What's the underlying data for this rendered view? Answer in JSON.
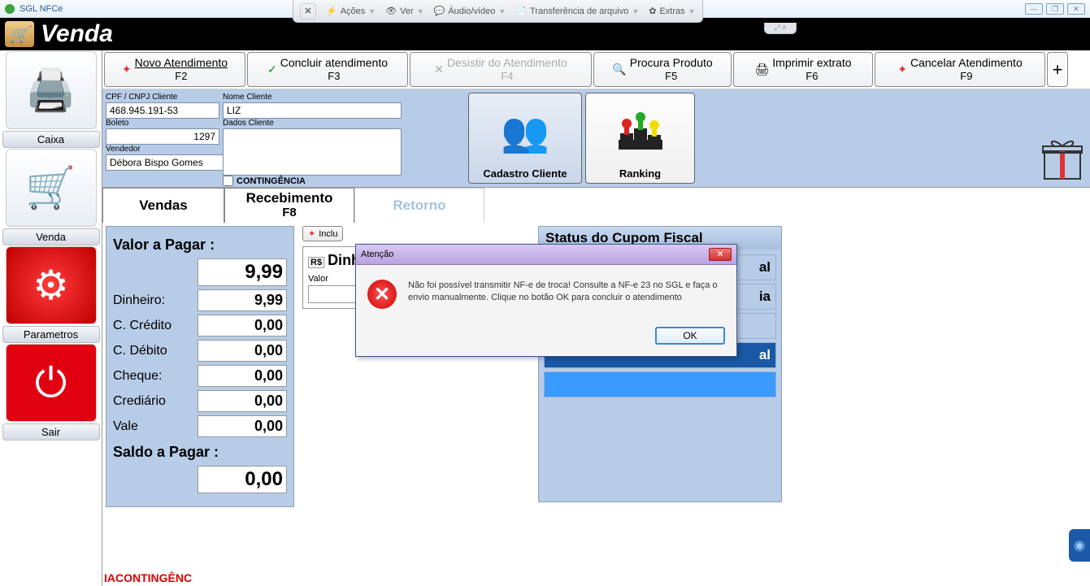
{
  "window": {
    "title": "SGL NFCe"
  },
  "remote_toolbar": {
    "actions": "Ações",
    "ver": "Ver",
    "audio": "Áudio/vídeo",
    "transfer": "Transferência de arquivo",
    "extras": "Extras"
  },
  "header": {
    "title": "Venda"
  },
  "sidebar": {
    "caixa": "Caixa",
    "venda": "Venda",
    "parametros": "Parametros",
    "sair": "Sair"
  },
  "actions": {
    "novo": {
      "label": "Novo Atendimento",
      "shortcut": "F2"
    },
    "concluir": {
      "label": "Concluir atendimento",
      "shortcut": "F3"
    },
    "desistir": {
      "label": "Desistir do Atendimento",
      "shortcut": "F4"
    },
    "procura": {
      "label": "Procura Produto",
      "shortcut": "F5"
    },
    "imprimir": {
      "label": "Imprimir extrato",
      "shortcut": "F6"
    },
    "cancelar": {
      "label": "Cancelar Atendimento",
      "shortcut": "F9"
    }
  },
  "client": {
    "cpf_label": "CPF / CNPJ Cliente",
    "cpf_value": "468.945.191-53",
    "nome_label": "Nome Cliente",
    "nome_value": "LIZ",
    "boleto_label": "Boleto",
    "boleto_value": "1297",
    "dados_label": "Dados Cliente",
    "dados_value": "",
    "vendedor_label": "Vendedor",
    "vendedor_value": "Débora Bispo Gomes",
    "contingencia_label": "CONTINGÊNCIA",
    "cadastro_btn": "Cadastro Cliente",
    "ranking_btn": "Ranking"
  },
  "tabs": {
    "vendas": "Vendas",
    "recebimento": {
      "label": "Recebimento",
      "shortcut": "F8"
    },
    "retorno": "Retorno"
  },
  "payment": {
    "title": "Valor a Pagar :",
    "total": "9,99",
    "rows": {
      "dinheiro": {
        "label": "Dinheiro:",
        "value": "9,99"
      },
      "ccredito": {
        "label": "C. Crédito",
        "value": "0,00"
      },
      "cdebito": {
        "label": "C. Débito",
        "value": "0,00"
      },
      "cheque": {
        "label": "Cheque:",
        "value": "0,00"
      },
      "crediario": {
        "label": "Crediário",
        "value": "0,00"
      },
      "vale": {
        "label": "Vale",
        "value": "0,00"
      }
    },
    "saldo_label": "Saldo a Pagar :",
    "saldo_value": "0,00"
  },
  "mid": {
    "incluir_btn": "Inclu",
    "dinh_title": "Dinh",
    "valor_label": "Valor"
  },
  "status": {
    "title": "Status do Cupom Fiscal",
    "row1": "al",
    "row2": "ia",
    "row3": "",
    "row4": "al",
    "row5": ""
  },
  "modal": {
    "title": "Atenção",
    "message": "Não foi possível transmitir NF-e de troca! Consulte a NF-e 23 no SGL e faça o envio manualmente. Clique no botão OK para concluir o atendimento",
    "ok": "OK"
  },
  "footer": {
    "text": "IACONTINGÊNC"
  }
}
